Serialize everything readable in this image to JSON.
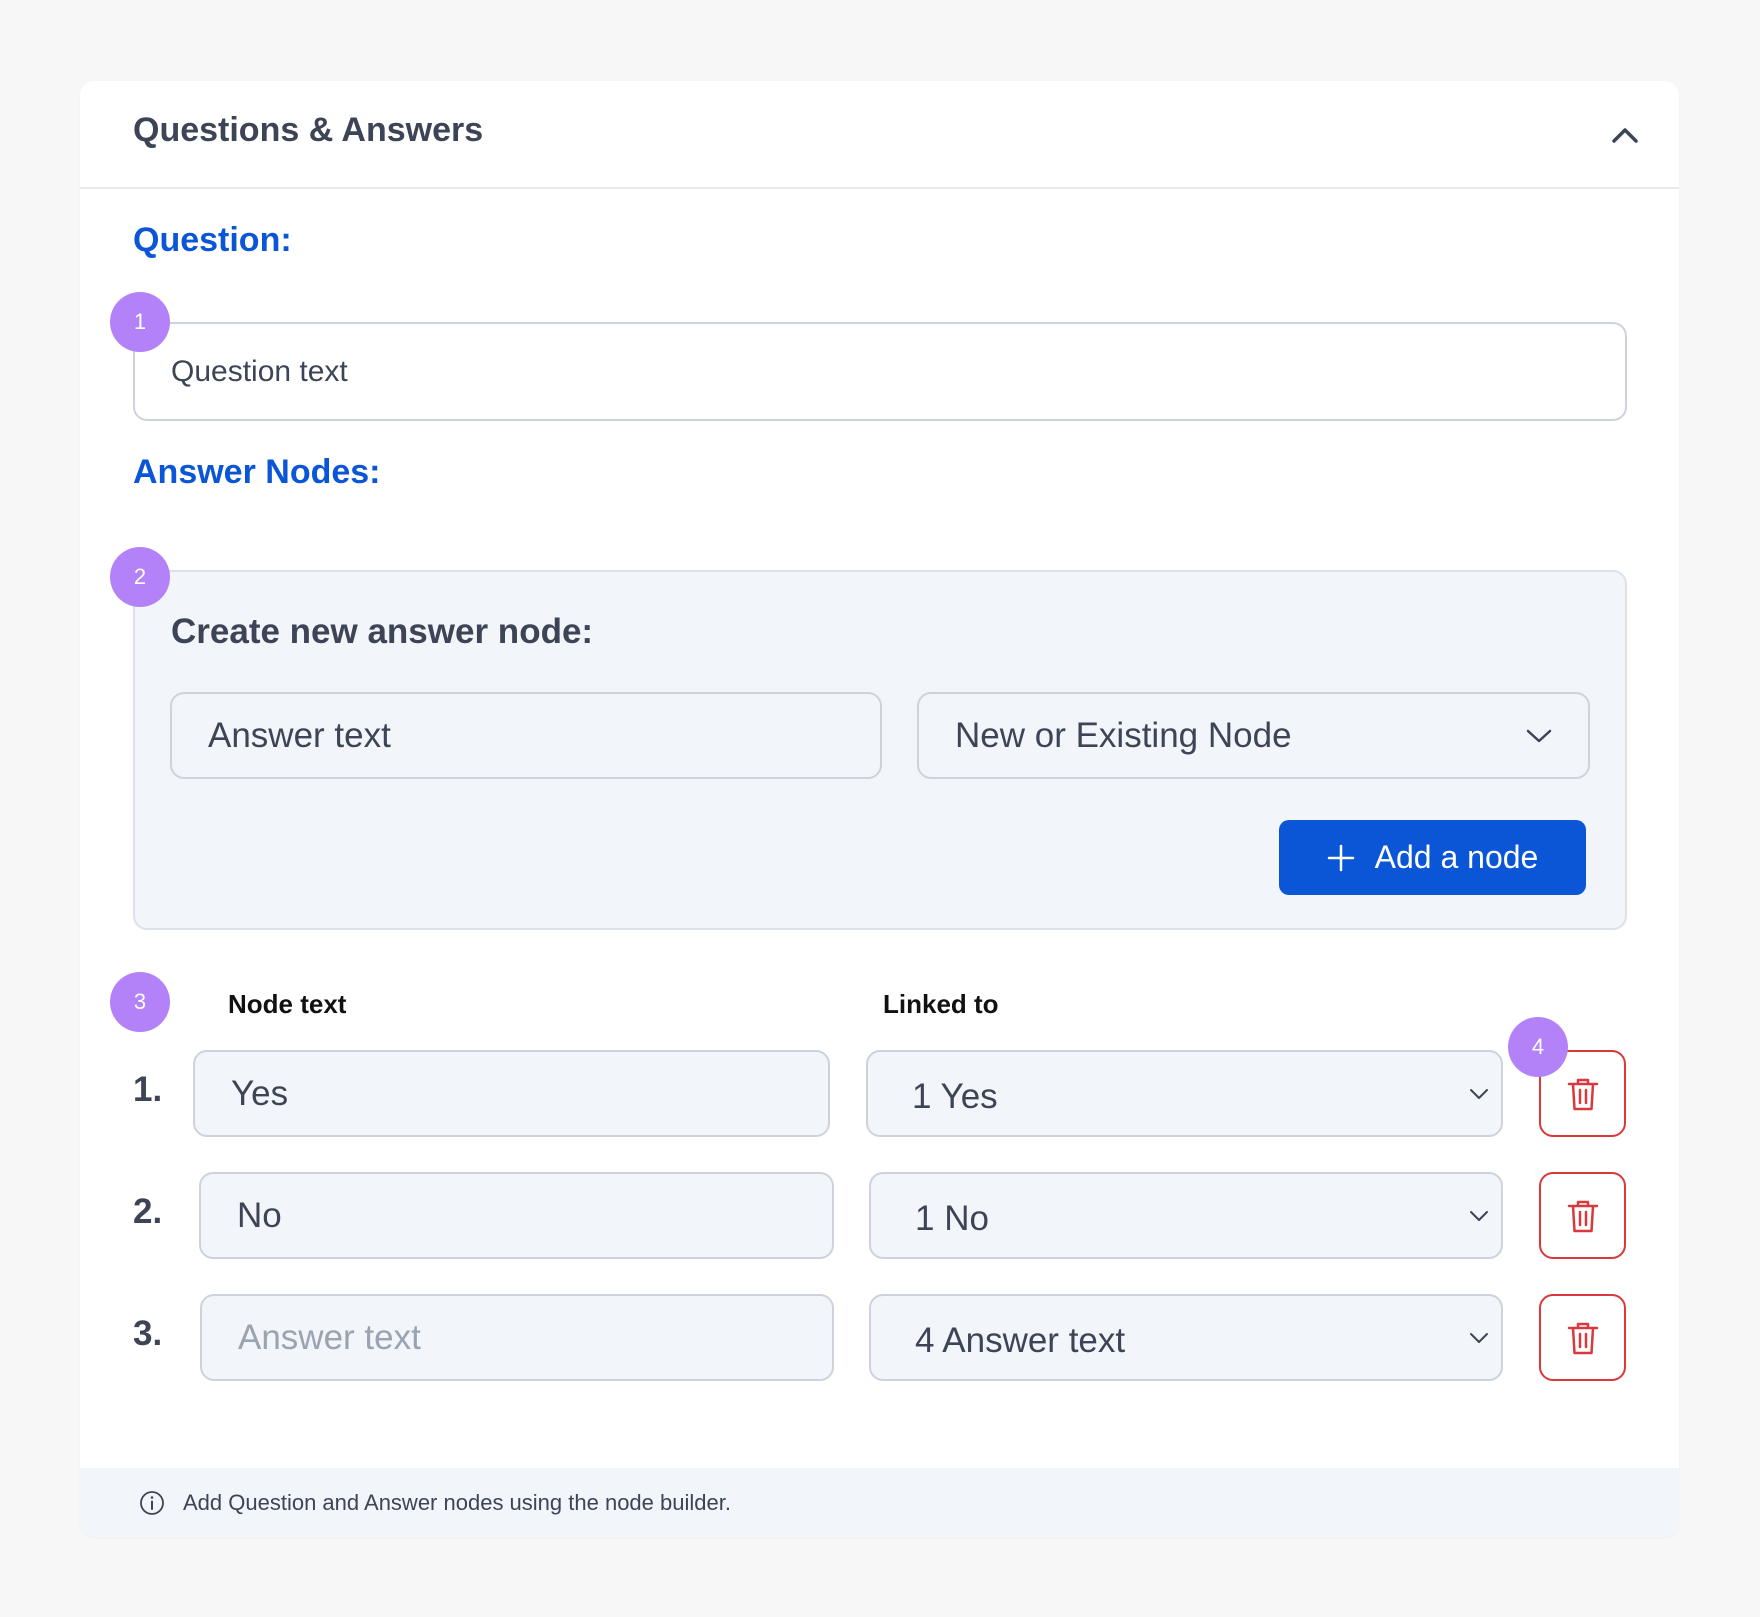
{
  "panel": {
    "title": "Questions & Answers",
    "collapse_icon": "chevron-up-icon"
  },
  "question": {
    "label": "Question:",
    "placeholder": "Question text",
    "badge": "1"
  },
  "answer_nodes": {
    "label": "Answer Nodes:",
    "builder": {
      "badge": "2",
      "title": "Create new answer node:",
      "answer_placeholder": "Answer text",
      "node_select_value": "New or Existing Node",
      "add_button_label": "Add a node",
      "add_icon": "plus-icon"
    },
    "list": {
      "badge": "3",
      "delete_badge": "4",
      "col_node_text": "Node text",
      "col_linked_to": "Linked to",
      "rows": [
        {
          "number": "1.",
          "node_text": "Yes",
          "linked_to": "1 Yes"
        },
        {
          "number": "2.",
          "node_text": "No",
          "linked_to": "1 No"
        },
        {
          "number": "3.",
          "node_text": "",
          "placeholder": "Answer text",
          "linked_to": "4 Answer text"
        }
      ]
    }
  },
  "footer": {
    "info_icon": "info-icon",
    "text": "Add Question and Answer nodes using the node builder."
  },
  "colors": {
    "accent_blue": "#0a56d6",
    "badge_purple": "#b482f8",
    "danger_red": "#d9393c",
    "text_dark": "#3c4456"
  }
}
